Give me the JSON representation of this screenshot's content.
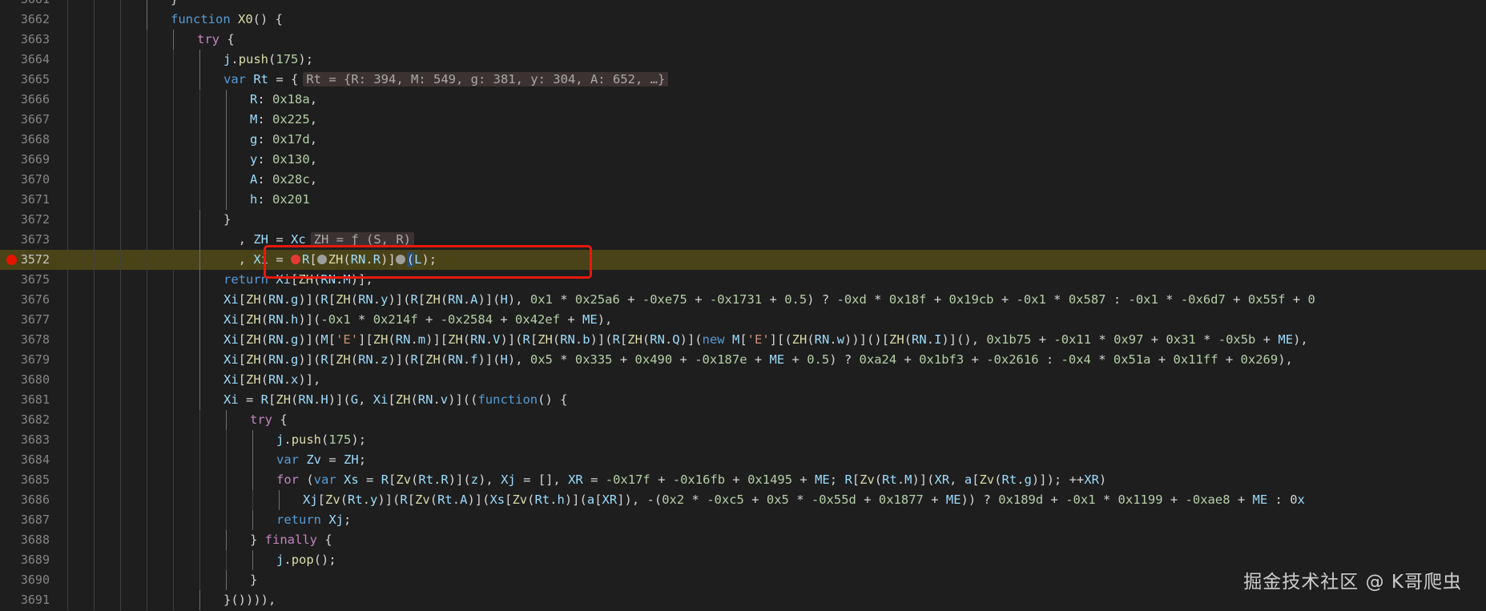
{
  "editor": {
    "lines": [
      {
        "ln": "3661",
        "depth": 4,
        "code": "}"
      },
      {
        "ln": "3662",
        "depth": 4,
        "code": "function X0() {"
      },
      {
        "ln": "3663",
        "depth": 5,
        "code": "try {"
      },
      {
        "ln": "3664",
        "depth": 6,
        "code": "j.push(175);"
      },
      {
        "ln": "3665",
        "depth": 6,
        "code": "var Rt = {",
        "hint": "Rt = {R: 394, M: 549, g: 381, y: 304, A: 652, …}"
      },
      {
        "ln": "3666",
        "depth": 7,
        "code": "R: 0x18a,"
      },
      {
        "ln": "3667",
        "depth": 7,
        "code": "M: 0x225,"
      },
      {
        "ln": "3668",
        "depth": 7,
        "code": "g: 0x17d,"
      },
      {
        "ln": "3669",
        "depth": 7,
        "code": "y: 0x130,"
      },
      {
        "ln": "3670",
        "depth": 7,
        "code": "A: 0x28c,"
      },
      {
        "ln": "3671",
        "depth": 7,
        "code": "h: 0x201"
      },
      {
        "ln": "3672",
        "depth": 6,
        "code": "}"
      },
      {
        "ln": "3673",
        "depth": 6,
        "code": "  , ZH = Xc",
        "hint": "ZH = ƒ (S, R)"
      },
      {
        "ln": "3572",
        "depth": 6,
        "code": "  , Xi = R[ZH(RN.R)](L);",
        "breakpoint": true
      },
      {
        "ln": "3675",
        "depth": 6,
        "code": "return Xi[ZH(RN.M)],"
      },
      {
        "ln": "3676",
        "depth": 6,
        "code": "Xi[ZH(RN.g)](R[ZH(RN.y)](R[ZH(RN.A)](H), 0x1 * 0x25a6 + -0xe75 + -0x1731 + 0.5) ? -0xd * 0x18f + 0x19cb + -0x1 * 0x587 : -0x1 * -0x6d7 + 0x55f + 0"
      },
      {
        "ln": "3677",
        "depth": 6,
        "code": "Xi[ZH(RN.h)](-0x1 * 0x214f + -0x2584 + 0x42ef + ME),"
      },
      {
        "ln": "3678",
        "depth": 6,
        "code": "Xi[ZH(RN.g)](M['E'][ZH(RN.m)][ZH(RN.V)](R[ZH(RN.b)](R[ZH(RN.Q)](new M['E'][(ZH(RN.w))]()[ZH(RN.I)](), 0x1b75 + -0x11 * 0x97 + 0x31 * -0x5b + ME),"
      },
      {
        "ln": "3679",
        "depth": 6,
        "code": "Xi[ZH(RN.g)](R[ZH(RN.z)](R[ZH(RN.f)](H), 0x5 * 0x335 + 0x490 + -0x187e + ME + 0.5) ? 0xa24 + 0x1bf3 + -0x2616 : -0x4 * 0x51a + 0x11ff + 0x269),"
      },
      {
        "ln": "3680",
        "depth": 6,
        "code": "Xi[ZH(RN.x)],"
      },
      {
        "ln": "3681",
        "depth": 6,
        "code": "Xi = R[ZH(RN.H)](G, Xi[ZH(RN.v)]((function() {"
      },
      {
        "ln": "3682",
        "depth": 7,
        "code": "try {"
      },
      {
        "ln": "3683",
        "depth": 8,
        "code": "j.push(175);"
      },
      {
        "ln": "3684",
        "depth": 8,
        "code": "var Zv = ZH;"
      },
      {
        "ln": "3685",
        "depth": 8,
        "code": "for (var Xs = R[Zv(Rt.R)](z), Xj = [], XR = -0x17f + -0x16fb + 0x1495 + ME; R[Zv(Rt.M)](XR, a[Zv(Rt.g)]); ++XR)"
      },
      {
        "ln": "3686",
        "depth": 9,
        "code": "Xj[Zv(Rt.y)](R[Zv(Rt.A)](Xs[Zv(Rt.h)](a[XR]), -(0x2 * -0xc5 + 0x5 * -0x55d + 0x1877 + ME)) ? 0x189d + -0x1 * 0x1199 + -0xae8 + ME : 0x"
      },
      {
        "ln": "3687",
        "depth": 8,
        "code": "return Xj;"
      },
      {
        "ln": "3688",
        "depth": 7,
        "code": "} finally {"
      },
      {
        "ln": "3689",
        "depth": 8,
        "code": "j.pop();"
      },
      {
        "ln": "3690",
        "depth": 7,
        "code": "}"
      },
      {
        "ln": "3691",
        "depth": 6,
        "code": "}()))),"
      }
    ]
  },
  "watermark": "掘金技术社区 @ K哥爬虫",
  "colors": {
    "background": "#1e1e1e",
    "current_line": "#4b4318",
    "breakpoint": "#e51400",
    "highlight_box": "#e8190d"
  }
}
